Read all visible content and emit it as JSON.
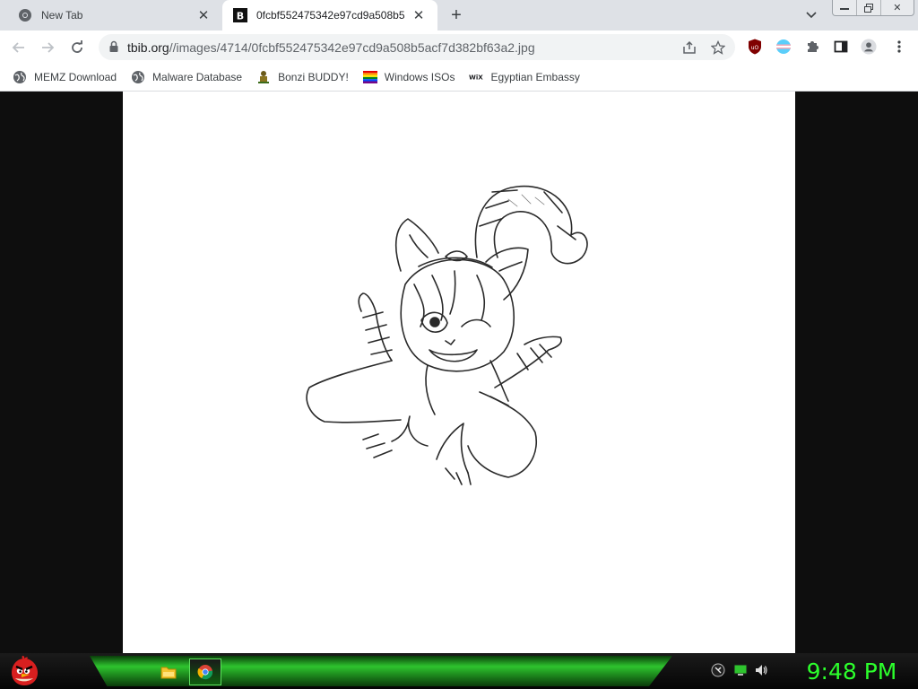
{
  "browser": {
    "tabs": [
      {
        "title": "New Tab",
        "favicon": "chrome-icon",
        "active": false
      },
      {
        "title": "0fcbf552475342e97cd9a508b5acf7d382bf63a2.jpg",
        "favicon": "tbib-icon",
        "active": true
      }
    ],
    "window_controls": [
      "minimize-icon",
      "restore-icon",
      "close-icon"
    ]
  },
  "toolbar": {
    "url_host": "tbib.org",
    "url_path": "//images/4714/0fcbf552475342e97cd9a508b5acf7d382bf63a2.jpg",
    "icons": [
      "back-icon",
      "forward-icon",
      "reload-icon",
      "lock-icon",
      "share-icon",
      "star-icon",
      "ublock-icon",
      "flag-extension-icon",
      "extensions-puzzle-icon",
      "side-panel-icon",
      "profile-icon",
      "menu-kebab-icon"
    ]
  },
  "bookmarks": [
    {
      "label": "MEMZ Download",
      "icon": "globe-icon"
    },
    {
      "label": "Malware Database",
      "icon": "globe-icon"
    },
    {
      "label": "Bonzi BUDDY!",
      "icon": "bonzi-icon"
    },
    {
      "label": "Windows ISOs",
      "icon": "rainbow-flag-icon"
    },
    {
      "label": "Egyptian Embassy",
      "icon": "wix-icon"
    }
  ],
  "content": {
    "image_kind": "pencil sketch of a cartoon cat-eared character lying down",
    "background_color": "#0e0e0e"
  },
  "taskbar": {
    "clock": "9:48 PM",
    "icons": [
      "angry-bird-start-icon",
      "file-explorer-icon",
      "chrome-icon"
    ],
    "tray_icons": [
      "network-icon",
      "battery-icon",
      "volume-icon"
    ],
    "accent_color": "#2cff2c"
  }
}
